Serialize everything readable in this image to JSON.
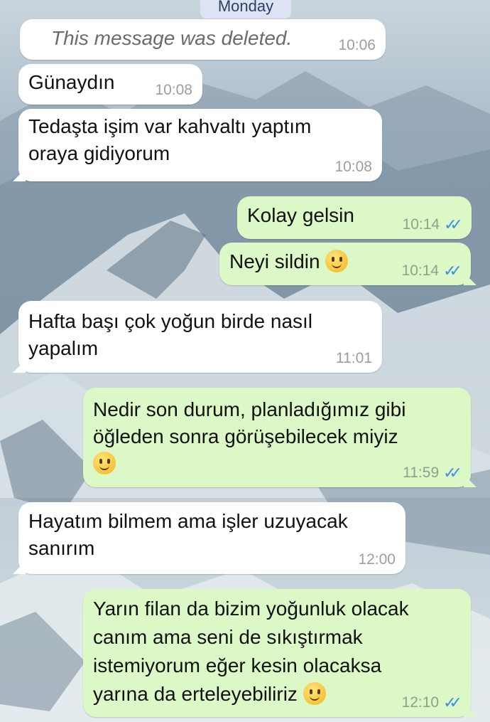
{
  "day_label": "Monday",
  "messages": [
    {
      "dir": "in",
      "text": "This message was deleted.",
      "time": "10:06",
      "deleted": true
    },
    {
      "dir": "in",
      "text": "Günaydın",
      "time": "10:08"
    },
    {
      "dir": "in",
      "text": "Tedaşta işim var kahvaltı yaptım\noraya gidiyorum",
      "time": "10:08"
    },
    {
      "dir": "out",
      "text": "Kolay gelsin",
      "time": "10:14",
      "ticks": "✓✓"
    },
    {
      "dir": "out",
      "text": "Neyi sildin",
      "emoji": "slightly-smiling-face",
      "time": "10:14",
      "ticks": "✓✓"
    },
    {
      "dir": "in",
      "text": "Hafta başı çok yoğun birde nasıl\nyapalım",
      "time": "11:01"
    },
    {
      "dir": "out",
      "text": "Nedir son durum, planladığımız gibi\nöğleden sonra görüşebilecek miyiz",
      "emoji": "slightly-smiling-face",
      "time": "11:59",
      "ticks": "✓✓"
    },
    {
      "dir": "in",
      "text": "Hayatım bilmem ama işler uzuyacak\nsanırım",
      "time": "12:00"
    },
    {
      "dir": "out",
      "text": "Yarın filan da bizim yoğunluk olacak\ncanım ama seni de sıkıştırmak\nistemiyorum eğer kesin olacaksa\nyarına da erteleyebiliriz",
      "emoji": "slightly-smiling-face",
      "time": "12:10",
      "ticks": "✓✓"
    }
  ],
  "colors": {
    "incoming": "#ffffff",
    "outgoing": "#dcf8c6",
    "read_ticks": "#3e8de8",
    "day_badge": "#dde3f3"
  }
}
